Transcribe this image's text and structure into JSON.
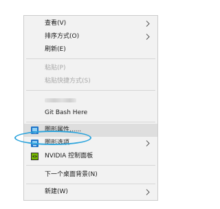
{
  "context_menu": {
    "items": [
      {
        "label": "查看(V)",
        "submenu": true
      },
      {
        "label": "排序方式(O)",
        "submenu": true
      },
      {
        "label": "刷新(E)"
      },
      {
        "label": "粘贴(P)",
        "disabled": true
      },
      {
        "label": "粘贴快捷方式(S)",
        "disabled": true
      },
      {
        "label": "Git Bash Here"
      },
      {
        "label": "图形属性......",
        "icon": "intel-graphics-icon",
        "highlighted": true
      },
      {
        "label": "图形选项",
        "icon": "intel-graphics-icon",
        "submenu": true
      },
      {
        "label": "NVIDIA 控制面板",
        "icon": "nvidia-icon"
      },
      {
        "label": "下一个桌面背景(N)"
      },
      {
        "label": "新建(W)",
        "submenu": true
      }
    ]
  },
  "colors": {
    "menu_background": "#f2f2f2",
    "highlight": "#dedede",
    "annotation_circle": "#2aa3dc",
    "disabled_text": "#a8a8a8"
  }
}
